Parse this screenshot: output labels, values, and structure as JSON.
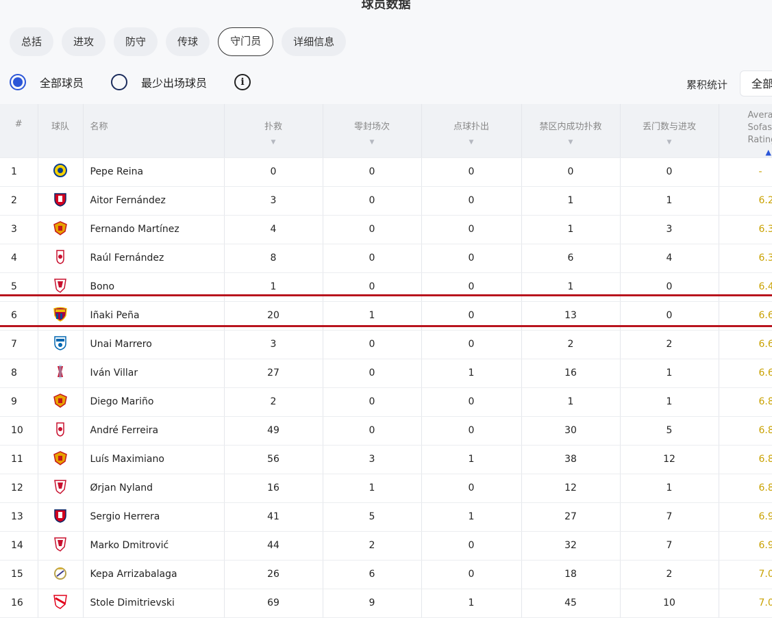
{
  "page_title": "球员数据",
  "tabs": [
    {
      "label": "总括",
      "active": false
    },
    {
      "label": "进攻",
      "active": false
    },
    {
      "label": "防守",
      "active": false
    },
    {
      "label": "传球",
      "active": false
    },
    {
      "label": "守门员",
      "active": true
    },
    {
      "label": "详细信息",
      "active": false
    }
  ],
  "filters": {
    "all_players": {
      "label": "全部球员",
      "selected": true
    },
    "min_appearances": {
      "label": "最少出场球员",
      "selected": false
    },
    "info_icon": "info-circle-icon",
    "cumulative_label": "累积统计",
    "cumulative_value": "全部"
  },
  "table": {
    "headers": {
      "rank": "#",
      "team": "球队",
      "name": "名称",
      "saves": "扑救",
      "clean_sheets": "零封场次",
      "penalties_saved": "点球扑出",
      "saves_inside_box": "禁区内成功扑救",
      "goals_conceded": "丢门数与进攻",
      "avg_rating": "Average Sofascore Rating"
    },
    "rows": [
      {
        "rank": "1",
        "crest": "villarreal-crest-icon",
        "name": "Pepe Reina",
        "saves": "0",
        "clean_sheets": "0",
        "penalties_saved": "0",
        "saves_inside_box": "0",
        "goals_conceded": "0",
        "rating": "-"
      },
      {
        "rank": "2",
        "crest": "osasuna-crest-icon",
        "name": "Aitor Fernández",
        "saves": "3",
        "clean_sheets": "0",
        "penalties_saved": "0",
        "saves_inside_box": "1",
        "goals_conceded": "1",
        "rating": "6.2"
      },
      {
        "rank": "3",
        "crest": "almeria-crest-icon",
        "name": "Fernando Martínez",
        "saves": "4",
        "clean_sheets": "0",
        "penalties_saved": "0",
        "saves_inside_box": "1",
        "goals_conceded": "3",
        "rating": "6.3"
      },
      {
        "rank": "4",
        "crest": "granada-crest-icon",
        "name": "Raúl Fernández",
        "saves": "8",
        "clean_sheets": "0",
        "penalties_saved": "0",
        "saves_inside_box": "6",
        "goals_conceded": "4",
        "rating": "6.3"
      },
      {
        "rank": "5",
        "crest": "sevilla-crest-icon",
        "name": "Bono",
        "saves": "1",
        "clean_sheets": "0",
        "penalties_saved": "0",
        "saves_inside_box": "1",
        "goals_conceded": "0",
        "rating": "6.4"
      },
      {
        "rank": "6",
        "crest": "barcelona-crest-icon",
        "name": "Iñaki Peña",
        "saves": "20",
        "clean_sheets": "1",
        "penalties_saved": "0",
        "saves_inside_box": "13",
        "goals_conceded": "0",
        "rating": "6.6"
      },
      {
        "rank": "7",
        "crest": "real-sociedad-crest-icon",
        "name": "Unai Marrero",
        "saves": "3",
        "clean_sheets": "0",
        "penalties_saved": "0",
        "saves_inside_box": "2",
        "goals_conceded": "2",
        "rating": "6.6"
      },
      {
        "rank": "8",
        "crest": "celta-crest-icon",
        "name": "Iván Villar",
        "saves": "27",
        "clean_sheets": "0",
        "penalties_saved": "1",
        "saves_inside_box": "16",
        "goals_conceded": "1",
        "rating": "6.6"
      },
      {
        "rank": "9",
        "crest": "almeria-crest-icon",
        "name": "Diego Mariño",
        "saves": "2",
        "clean_sheets": "0",
        "penalties_saved": "0",
        "saves_inside_box": "1",
        "goals_conceded": "1",
        "rating": "6.8"
      },
      {
        "rank": "10",
        "crest": "granada-crest-icon",
        "name": "André Ferreira",
        "saves": "49",
        "clean_sheets": "0",
        "penalties_saved": "0",
        "saves_inside_box": "30",
        "goals_conceded": "5",
        "rating": "6.8"
      },
      {
        "rank": "11",
        "crest": "almeria-crest-icon",
        "name": "Luís Maximiano",
        "saves": "56",
        "clean_sheets": "3",
        "penalties_saved": "1",
        "saves_inside_box": "38",
        "goals_conceded": "12",
        "rating": "6.8"
      },
      {
        "rank": "12",
        "crest": "sevilla-crest-icon",
        "name": "Ørjan Nyland",
        "saves": "16",
        "clean_sheets": "1",
        "penalties_saved": "0",
        "saves_inside_box": "12",
        "goals_conceded": "1",
        "rating": "6.8"
      },
      {
        "rank": "13",
        "crest": "osasuna-crest-icon",
        "name": "Sergio Herrera",
        "saves": "41",
        "clean_sheets": "5",
        "penalties_saved": "1",
        "saves_inside_box": "27",
        "goals_conceded": "7",
        "rating": "6.9"
      },
      {
        "rank": "14",
        "crest": "sevilla-crest-icon",
        "name": "Marko Dmitrović",
        "saves": "44",
        "clean_sheets": "2",
        "penalties_saved": "0",
        "saves_inside_box": "32",
        "goals_conceded": "7",
        "rating": "6.9"
      },
      {
        "rank": "15",
        "crest": "real-madrid-crest-icon",
        "name": "Kepa Arrizabalaga",
        "saves": "26",
        "clean_sheets": "6",
        "penalties_saved": "0",
        "saves_inside_box": "18",
        "goals_conceded": "2",
        "rating": "7.0"
      },
      {
        "rank": "16",
        "crest": "rayo-crest-icon",
        "name": "Stole Dimitrievski",
        "saves": "69",
        "clean_sheets": "9",
        "penalties_saved": "1",
        "saves_inside_box": "45",
        "goals_conceded": "10",
        "rating": "7.0"
      }
    ],
    "highlighted_rank": "6"
  },
  "colors": {
    "accent_blue": "#2b56d8",
    "highlight_red": "#b8141d",
    "rating_gold": "#c9a100"
  }
}
